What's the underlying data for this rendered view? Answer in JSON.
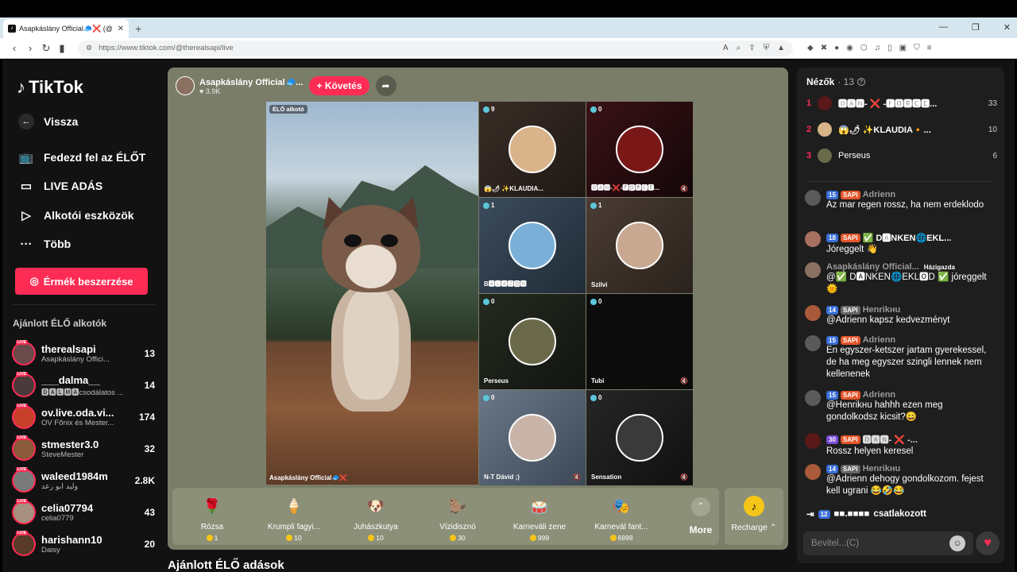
{
  "browser": {
    "tab_title": "Asapkáslány Official🧢❌ (@",
    "url": "https://www.tiktok.com/@therealsapi/live"
  },
  "sidebar": {
    "logo": "TikTok",
    "back": "Vissza",
    "nav": [
      "Fedezd fel az ÉLŐT",
      "LIVE ADÁS",
      "Alkotói eszközök",
      "Több"
    ],
    "coins_button": "Érmék beszerzése",
    "section_title": "Ajánlott ÉLŐ alkotók",
    "live_badge": "LIVE",
    "creators": [
      {
        "name": "therealsapi",
        "sub": "Asapkáslány Offici...",
        "count": "13"
      },
      {
        "name": "___dalma__",
        "sub": "🅳🅰🅻🅼🅰csodálatos ...",
        "count": "14"
      },
      {
        "name": "ov.live.oda.vi...",
        "sub": "OV Főnix és Mester...",
        "count": "174"
      },
      {
        "name": "stmester3.0",
        "sub": "SteveMester",
        "count": "32"
      },
      {
        "name": "waleed1984m",
        "sub": "وليد ابو رعد",
        "count": "2.8K"
      },
      {
        "name": "celia07794",
        "sub": "celia0779",
        "count": "43"
      },
      {
        "name": "harishann10",
        "sub": "Daisy",
        "count": "20"
      }
    ]
  },
  "player": {
    "host_name": "Asapkáslány Official🧢...",
    "host_likes": "3.9K",
    "follow": "+ Követés",
    "main_tag": "ÉLŐ alkotó",
    "main_label": "Asapkáslány Official🧢❌",
    "tiles": [
      {
        "count": "9",
        "label": "😱🌶 ✨KLAUDIA..."
      },
      {
        "count": "0",
        "label": "🅳🅰🅽-❌-🅵🅾🆁🅲🅴..."
      },
      {
        "count": "1",
        "label": "B🅰🅻🅰🆉🅾🅽"
      },
      {
        "count": "1",
        "label": "Szilvi"
      },
      {
        "count": "0",
        "label": "Perseus"
      },
      {
        "count": "0",
        "label": "Tubi"
      },
      {
        "count": "0",
        "label": "N-T Dávid ;)"
      },
      {
        "count": "0",
        "label": "Sensation"
      }
    ],
    "gifts": [
      {
        "name": "Rózsa",
        "price": "1",
        "icon": "🌹"
      },
      {
        "name": "Krumpli fagyi...",
        "price": "10",
        "icon": "🍦"
      },
      {
        "name": "Juhászkutya",
        "price": "10",
        "icon": "🐶"
      },
      {
        "name": "Vízidisznó",
        "price": "30",
        "icon": "🦫"
      },
      {
        "name": "Karneváli zene",
        "price": "999",
        "icon": "🥁"
      },
      {
        "name": "Karnevál fant...",
        "price": "6999",
        "icon": "🎭"
      }
    ],
    "more": "More",
    "recharge": "Recharge ⌃",
    "below_title": "Ajánlott ÉLŐ adások"
  },
  "chat": {
    "viewers_title": "Nézők",
    "viewers_count": "· 13",
    "top_viewers": [
      {
        "rank": "1",
        "name": "🅳🅰🅽- ❌ -🅵🅾🆁🅲🅴...",
        "score": "33"
      },
      {
        "rank": "2",
        "name": "😱🌶 ✨KLAUDIA🔸...",
        "score": "10"
      },
      {
        "rank": "3",
        "name": "Perseus",
        "score": "6"
      }
    ],
    "messages": [
      {
        "level": "15",
        "badge": "SAPI",
        "name": "Adrienn",
        "text": "Az mar regen rossz, ha nem erdeklodo"
      },
      {
        "level": "18",
        "badge": "SAPI",
        "name": "✅ D🅰NKEN🌐EKL...",
        "text": "Jóreggelt 👋"
      },
      {
        "level": "",
        "badge": "Házigazda",
        "name": "Asapkáslány Official...",
        "text": "@✅ D🅰NKEN🌐EKL🅾D ✅ jóreggelt🌞"
      },
      {
        "level": "14",
        "badge": "SAPI",
        "name": "Henrikнu",
        "text": "@Adrienn kapsz kedvezményt"
      },
      {
        "level": "15",
        "badge": "SAPI",
        "name": "Adrienn",
        "text": "En egyszer-ketszer jartam gyerekessel, de ha meg egyszer szingli lennek nem kellenenek"
      },
      {
        "level": "15",
        "badge": "SAPI",
        "name": "Adrienn",
        "text": "@Henrikнu hahhh ezen meg gondolkodsz kicsit?😄"
      },
      {
        "level": "30",
        "badge": "SAPI",
        "name": "🅳🅰🅽- ❌ -...",
        "text": "Rossz helyen keresel"
      },
      {
        "level": "14",
        "badge": "SAPI",
        "name": "Henrikнu",
        "text": "@Adrienn dehogy gondolkozom. fejest kell ugrani 😂🤣😂"
      }
    ],
    "joined_level": "12",
    "joined_name": "■■.■■■■",
    "joined_text": "csatlakozott",
    "input_placeholder": "Bevitel...(C)"
  }
}
